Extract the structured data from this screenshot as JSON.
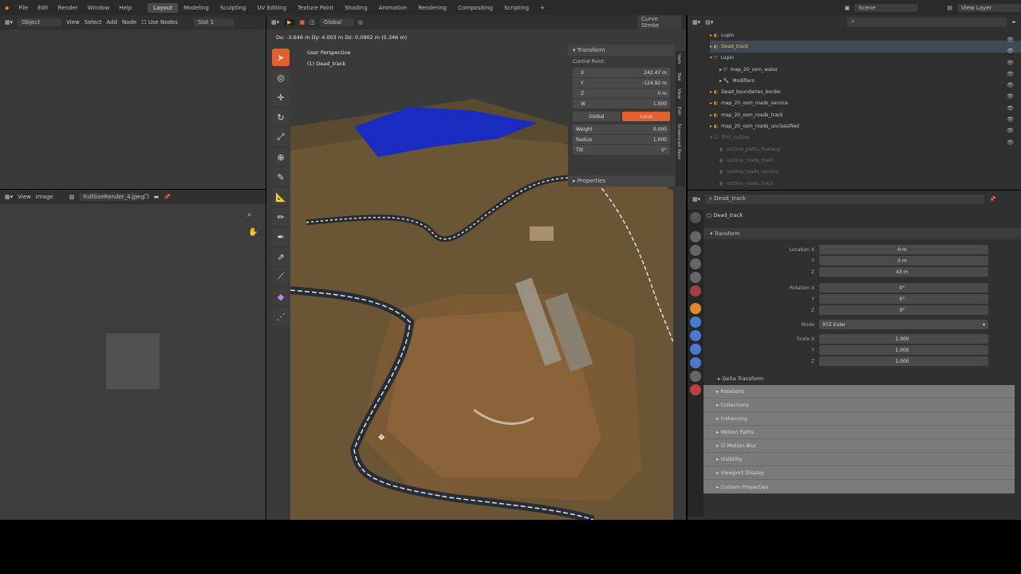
{
  "topbar": {
    "menus": [
      "File",
      "Edit",
      "Render",
      "Window",
      "Help"
    ],
    "workspaces": [
      "Layout",
      "Modeling",
      "Sculpting",
      "UV Editing",
      "Texture Paint",
      "Shading",
      "Animation",
      "Rendering",
      "Compositing",
      "Scripting"
    ],
    "active_workspace": "Layout",
    "scene": "Scene",
    "view_layer": "View Layer"
  },
  "node_editor": {
    "mode": "Object",
    "menus": [
      "View",
      "Select",
      "Add",
      "Node"
    ],
    "use_nodes": "Use Nodes",
    "slot": "Slot 1"
  },
  "image_editor": {
    "menus": [
      "View",
      "Image"
    ],
    "image_name": "FullSizeRender_4.jpeg"
  },
  "viewport": {
    "status": "Dx: -3.646 m  Dy: 4.003 m  Dz: 0.0902 m (5.346 m)",
    "perspective": "User Perspective",
    "object_label": "(1) Dead_track",
    "orientation": "Global",
    "pivot": "Curve Stroke"
  },
  "transform_panel": {
    "title": "Transform",
    "section": "Control Point:",
    "x": "242.47 m",
    "y": "-124.92 m",
    "z": "0 m",
    "w": "1.000",
    "space_global": "Global",
    "space_local": "Local",
    "weight_label": "Weight",
    "weight": "0.000",
    "radius_label": "Radius",
    "radius": "1.000",
    "tilt_label": "Tilt",
    "tilt": "0°",
    "properties_label": "Properties"
  },
  "side_tabs": [
    "Item",
    "Tool",
    "View",
    "Edit",
    "Screencast Keys"
  ],
  "outliner": {
    "rows": [
      {
        "label": "Lupin",
        "state": "normal"
      },
      {
        "label": "Dead_track",
        "state": "selected"
      },
      {
        "label": "Lupin",
        "state": "normal"
      },
      {
        "label": "map_20_osm_water",
        "state": "normal"
      },
      {
        "label": "Modifiers",
        "state": "normal"
      },
      {
        "label": "Dead_boundaries_border",
        "state": "normal"
      },
      {
        "label": "map_20_osm_roads_service",
        "state": "normal"
      },
      {
        "label": "map_20_osm_roads_track",
        "state": "normal"
      },
      {
        "label": "map_20_osm_roads_unclassified",
        "state": "normal"
      },
      {
        "label": "first_outline",
        "state": "dim"
      },
      {
        "label": "outline_paths_footway",
        "state": "dim"
      },
      {
        "label": "outline_roads_main",
        "state": "dim"
      },
      {
        "label": "outline_roads_service",
        "state": "dim"
      },
      {
        "label": "outline_roads_track",
        "state": "dim"
      }
    ]
  },
  "properties": {
    "object_name": "Dead_track",
    "breadcrumb": "Dead_track",
    "transform_title": "Transform",
    "location_label": "Location X",
    "location": [
      "0 m",
      "0 m",
      "43 m"
    ],
    "rotation_label": "Rotation X",
    "rotation": [
      "0°",
      "0°",
      "0°"
    ],
    "mode_label": "Mode",
    "mode": "XYZ Euler",
    "scale_label": "Scale X",
    "scale": [
      "1.000",
      "1.000",
      "1.000"
    ],
    "axis_y": "Y",
    "axis_z": "Z",
    "delta_transform": "Delta Transform",
    "sections": [
      "Relations",
      "Collections",
      "Instancing",
      "Motion Paths",
      "Motion Blur",
      "Visibility",
      "Viewport Display",
      "Custom Properties"
    ]
  },
  "colors": {
    "accent": "#e06030",
    "selected_text": "#f2c043",
    "bg_dark": "#2a2a2a",
    "panel": "#333333",
    "water": "#1a2cc0"
  }
}
